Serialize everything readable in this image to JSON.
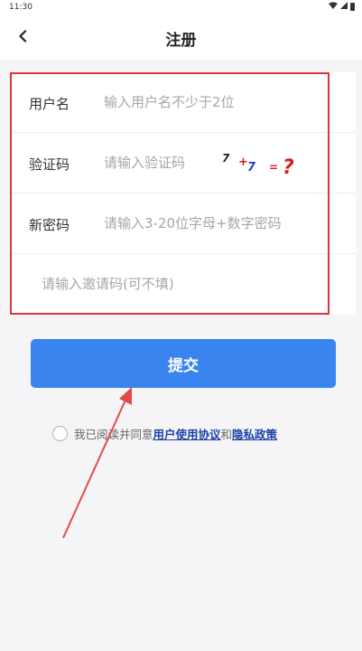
{
  "status_bar": {
    "time": "11:30",
    "icons": [
      "wifi-icon",
      "signal-icon",
      "battery-icon"
    ]
  },
  "header": {
    "back_icon": "chevron-left-icon",
    "title": "注册"
  },
  "form": {
    "username": {
      "label": "用户名",
      "placeholder": "输入用户名不少于2位",
      "value": ""
    },
    "captcha": {
      "label": "验证码",
      "placeholder": "请输入验证码",
      "value": "",
      "image_text": {
        "a": "7",
        "op": "+",
        "b": "7",
        "eq": "=",
        "q": "?"
      }
    },
    "password": {
      "label": "新密码",
      "placeholder": "请输入3-20位字母+数字密码",
      "value": ""
    },
    "invite": {
      "placeholder": "请输入邀请码(可不填)",
      "value": ""
    }
  },
  "submit_label": "提交",
  "agreement": {
    "checked": false,
    "prefix": "我已阅读并同意",
    "terms_link": "用户使用协议",
    "conjunction": "和",
    "privacy_link": "隐私政策"
  },
  "colors": {
    "primary": "#3a84f0",
    "highlight_border": "#d9383a",
    "link": "#1c3fa8",
    "background": "#f5f5f7"
  }
}
